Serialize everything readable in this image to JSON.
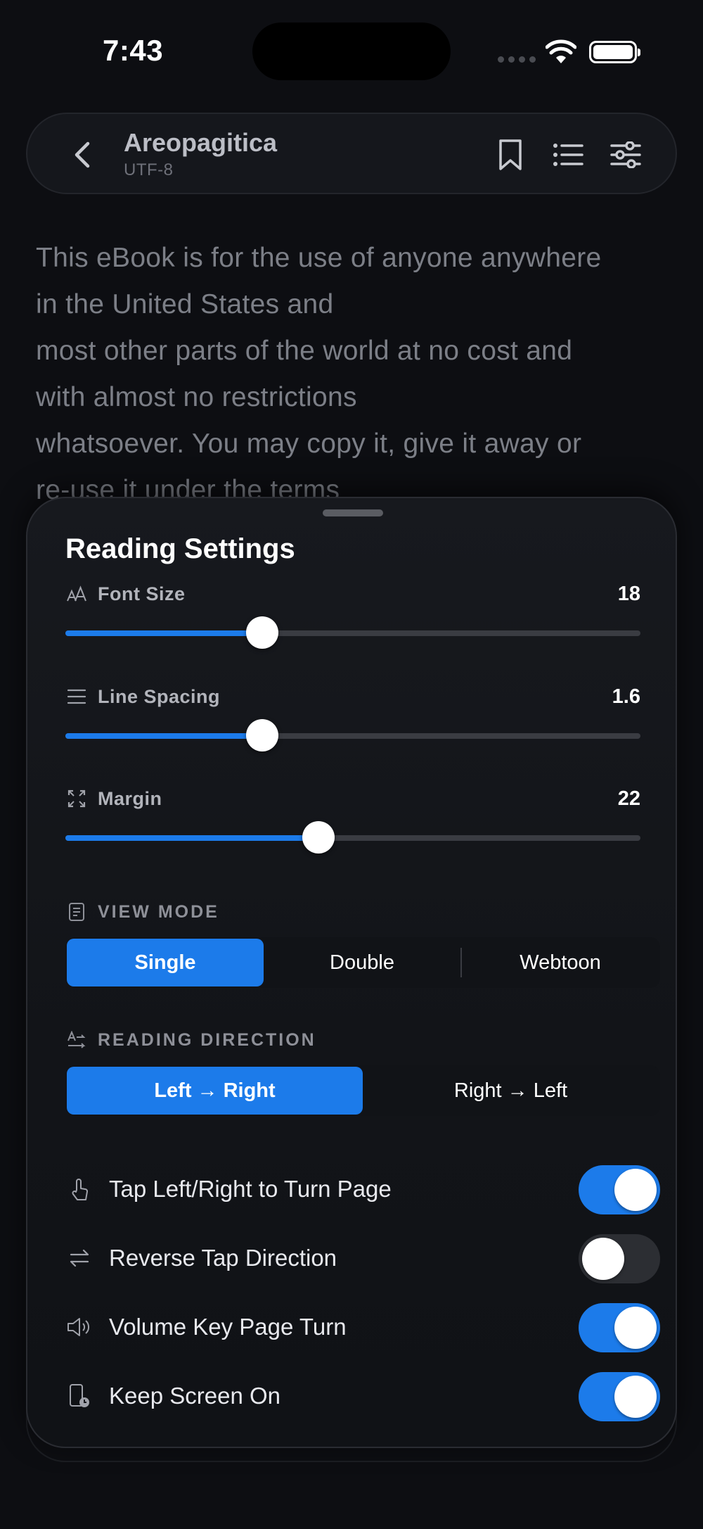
{
  "status_bar": {
    "time": "7:43"
  },
  "header": {
    "title": "Areopagitica",
    "subtitle": "UTF-8"
  },
  "book": {
    "lines": [
      "This eBook is for the use of anyone anywhere",
      "in the United States and",
      "most other parts of the world at no cost and",
      "with almost no restrictions",
      "whatsoever. You may copy it, give it away or",
      "re-use it under the terms"
    ]
  },
  "settings": {
    "title": "Reading Settings",
    "font_size": {
      "label": "Font Size",
      "value": "18",
      "fraction": 0.342
    },
    "line_spacing": {
      "label": "Line Spacing",
      "value": "1.6",
      "fraction": 0.342
    },
    "margin": {
      "label": "Margin",
      "value": "22",
      "fraction": 0.44
    },
    "view_mode": {
      "label": "VIEW MODE",
      "options": [
        "Single",
        "Double",
        "Webtoon"
      ],
      "selected": "Single"
    },
    "reading_direction": {
      "label": "READING DIRECTION",
      "options": [
        "Left → Right",
        "Right → Left"
      ],
      "selected": "Left → Right"
    },
    "toggles": [
      {
        "label": "Tap Left/Right to Turn Page",
        "on": true
      },
      {
        "label": "Reverse Tap Direction",
        "on": false
      },
      {
        "label": "Volume Key Page Turn",
        "on": true
      },
      {
        "label": "Keep Screen On",
        "on": true
      }
    ]
  },
  "colors": {
    "accent": "#1c7bea",
    "background": "#0d0e12",
    "sheet": "#15171c"
  },
  "icons": {
    "back": "chevron-left-icon",
    "bookmark": "bookmark-icon",
    "toc": "list-icon",
    "settings": "sliders-icon",
    "font_size": "text-size-icon",
    "line_spacing": "line-spacing-icon",
    "margin": "expand-icon",
    "view_mode": "document-icon",
    "reading_direction": "text-direction-icon",
    "tap": "tap-hand-icon",
    "reverse": "swap-arrows-icon",
    "volume": "speaker-icon",
    "screen": "phone-clock-icon"
  }
}
